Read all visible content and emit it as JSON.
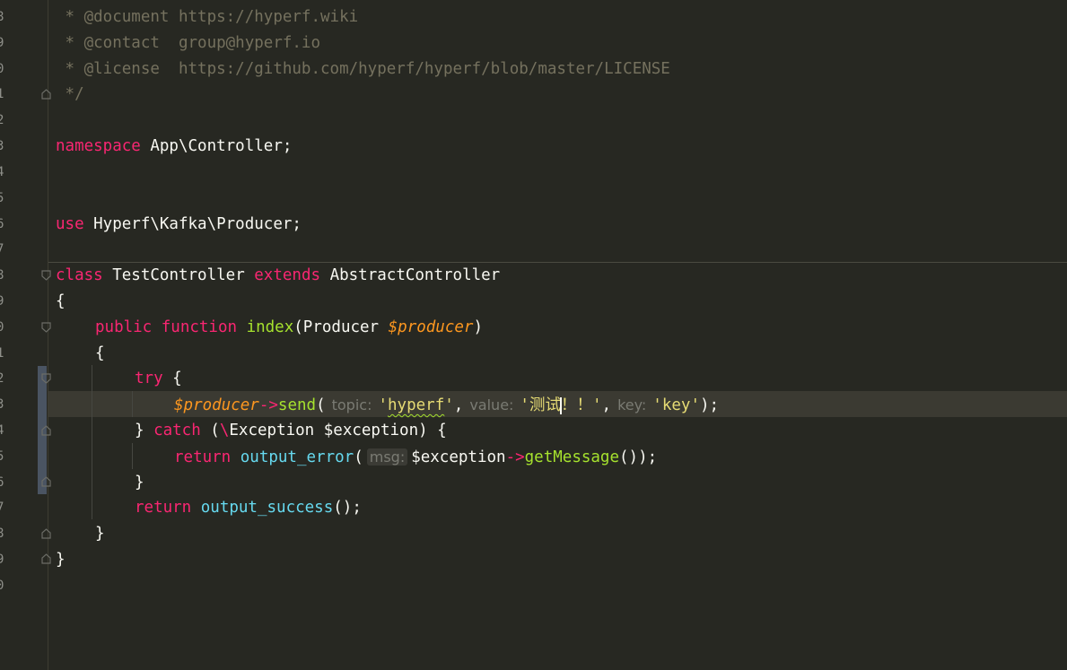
{
  "gutter": {
    "line_numbers": [
      "8",
      "9",
      "0",
      "1",
      "2",
      "3",
      "4",
      "5",
      "6",
      "7",
      "8",
      "9",
      "0",
      "1",
      "2",
      "3",
      "4",
      "5",
      "6",
      "7",
      "8",
      "9",
      "0"
    ]
  },
  "code": {
    "doc_document": " * @document https://hyperf.wiki",
    "doc_contact": " * @contact  group@hyperf.io",
    "doc_license": " * @license  https://github.com/hyperf/hyperf/blob/master/LICENSE",
    "doc_end": " */",
    "namespace_kw": "namespace",
    "namespace_name": " App\\Controller;",
    "use_kw": "use",
    "use_name": " Hyperf\\Kafka\\Producer;",
    "class_kw": "class",
    "class_name": " TestController ",
    "extends_kw": "extends",
    "parent_name": " AbstractController",
    "open_brace_class": "{",
    "public_kw": "public",
    "function_kw": " function ",
    "method_name": "index",
    "param_open": "(Producer ",
    "param_var": "$producer",
    "param_close": ")",
    "open_brace_method": "{",
    "try_kw": "try",
    "try_brace": " {",
    "producer_var": "$producer",
    "arrow1": "->",
    "send_fn": "send",
    "send_open": "(",
    "hint_topic": "topic:",
    "str_hyperf_q1": "'",
    "str_hyperf": "hyperf",
    "str_hyperf_q2": "'",
    "comma1": ",",
    "hint_value": "value:",
    "str_value_a": "'测试",
    "str_value_b": "！！'",
    "comma2": ",",
    "hint_key": "key:",
    "str_key": "'key'",
    "send_close": ");",
    "catch_close_brace": "} ",
    "catch_kw": "catch",
    "catch_paren": " (",
    "catch_backslash": "\\",
    "catch_rest": "Exception $exception) {",
    "return_kw": "return",
    "output_error_fn": " output_error",
    "err_open": "(",
    "hint_msg": "msg:",
    "exception_var": "$exception",
    "arrow2": "->",
    "getmessage_fn": "getMessage",
    "err_close": "());",
    "close_brace_try": "}",
    "return_kw2": "return",
    "output_success_fn": " output_success",
    "success_close": "();",
    "close_brace_method": "}",
    "close_brace_class": "}"
  },
  "colors": {
    "background": "#272822",
    "keyword": "#f92672",
    "function": "#a6e22e",
    "call": "#66d9ef",
    "variable": "#fd971f",
    "string": "#e6db74",
    "comment": "#75715e"
  }
}
